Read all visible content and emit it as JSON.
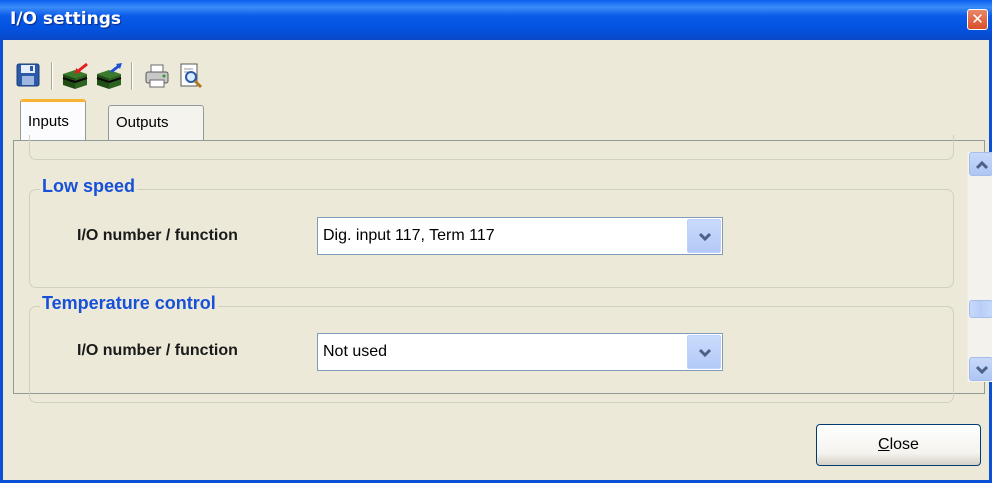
{
  "window": {
    "title": "I/O settings",
    "close_glyph": "✕"
  },
  "toolbar": {
    "buttons": [
      {
        "icon": "save-icon"
      },
      {
        "icon": "import-icon"
      },
      {
        "icon": "export-icon"
      },
      {
        "icon": "print-icon"
      },
      {
        "icon": "print-preview-icon"
      }
    ]
  },
  "tabs": [
    {
      "label": "Inputs",
      "active": true
    },
    {
      "label": "Outputs",
      "active": false
    }
  ],
  "groups": [
    {
      "title": "Low speed",
      "field_label": "I/O number / function",
      "value": "Dig. input 117, Term 117"
    },
    {
      "title": "Temperature control",
      "field_label": "I/O number / function",
      "value": "Not used"
    }
  ],
  "footer": {
    "close_label_accel": "C",
    "close_label_rest": "lose"
  },
  "colors": {
    "titlebar": "#0353e0",
    "group_title": "#1750d8",
    "window_bg": "#ece9d8",
    "active_tab_accent": "#f8b332"
  }
}
